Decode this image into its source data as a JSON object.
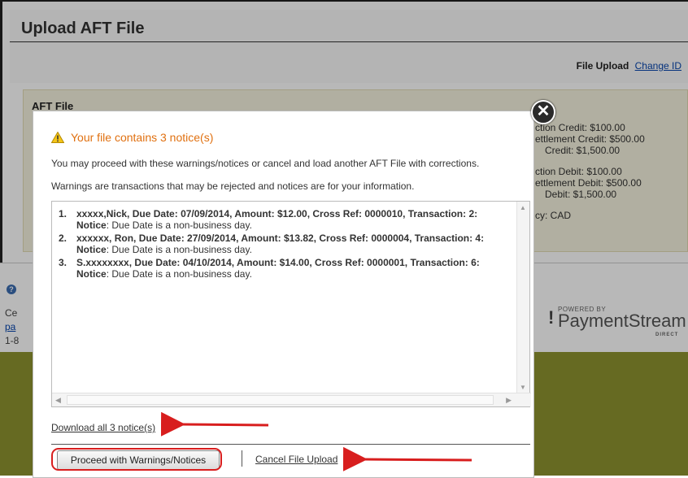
{
  "page": {
    "title": "Upload AFT File",
    "file_upload_label": "File Upload",
    "change_id_link": "Change ID"
  },
  "aft_panel": {
    "title": "AFT File",
    "info_lines": [
      "ction Credit: $100.00",
      "ettlement Credit: $500.00",
      "Credit: $1,500.00",
      "ction Debit: $100.00",
      "ettlement Debit: $500.00",
      "Debit: $1,500.00",
      "cy: CAD"
    ]
  },
  "footer": {
    "text_lines": [
      "Ce",
      "pa",
      "1-8"
    ],
    "powered_by": "POWERED BY",
    "brand_name": "PaymentStream",
    "brand_sub": "DIRECT"
  },
  "modal": {
    "heading": "Your file contains 3 notice(s)",
    "line1": "You may proceed with these warnings/notices or cancel and load another AFT File with corrections.",
    "line2": "Warnings are transactions that may be rejected and notices are for your information.",
    "notices": [
      {
        "num": "1.",
        "main": "xxxxx,Nick, Due Date: 07/09/2014, Amount: $12.00, Cross Ref: 0000010, Transaction: 2:",
        "label": "Notice",
        "detail": ": Due Date is a non-business day."
      },
      {
        "num": "2.",
        "main": "xxxxxx, Ron, Due Date: 27/09/2014, Amount: $13.82, Cross Ref: 0000004, Transaction: 4:",
        "label": "Notice",
        "detail": ": Due Date is a non-business day."
      },
      {
        "num": "3.",
        "main": "S.xxxxxxxx, Due Date: 04/10/2014, Amount: $14.00, Cross Ref: 0000001, Transaction: 6:",
        "label": "Notice",
        "detail": ": Due Date is a non-business day."
      }
    ],
    "download_link": "Download all 3 notice(s)",
    "proceed_button": "Proceed with Warnings/Notices",
    "cancel_link": "Cancel File Upload"
  },
  "colors": {
    "notice_orange": "#e07010",
    "panel_bg": "#f6f3df",
    "olive_band": "#8e9330",
    "annotation_red": "#d81e1e"
  }
}
